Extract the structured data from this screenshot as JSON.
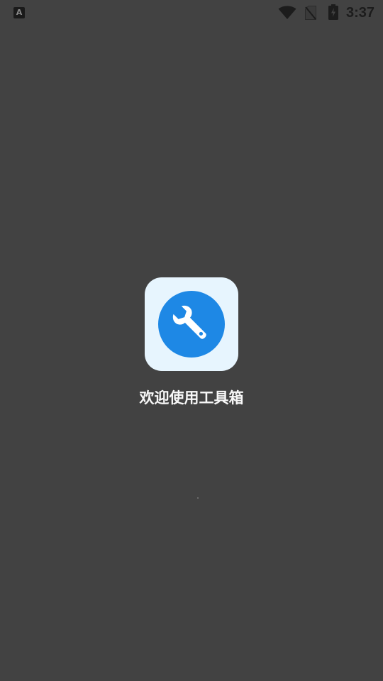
{
  "status_bar": {
    "notification_icon": "a-icon",
    "notification_glyph": "A",
    "wifi_icon": "wifi-icon",
    "sim_icon": "no-sim-icon",
    "battery_icon": "battery-charging-icon",
    "time": "3:37"
  },
  "splash": {
    "app_icon": "wrench-icon",
    "welcome_text": "欢迎使用工具箱",
    "colors": {
      "background": "#424242",
      "icon_tile": "#e7f5fe",
      "icon_circle": "#1e88e5",
      "text": "#f7f7f7"
    }
  }
}
